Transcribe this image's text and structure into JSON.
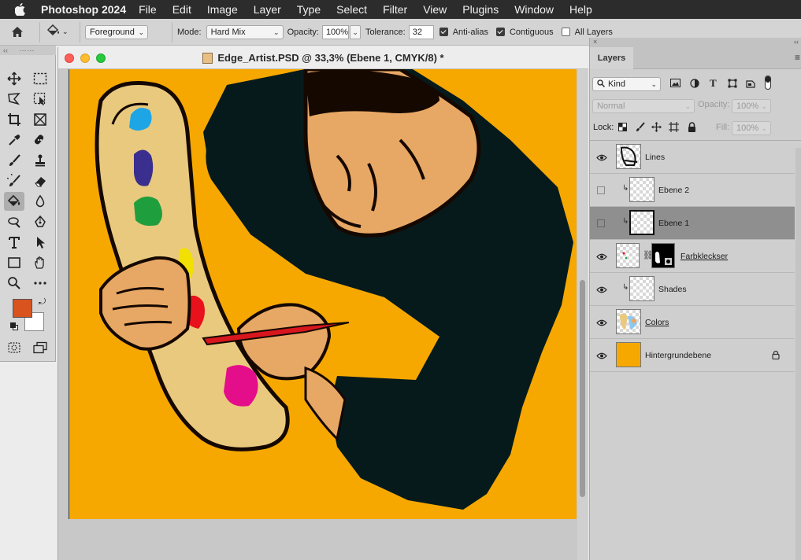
{
  "menubar": {
    "app_name": "Photoshop 2024",
    "items": [
      "File",
      "Edit",
      "Image",
      "Layer",
      "Type",
      "Select",
      "Filter",
      "View",
      "Plugins",
      "Window",
      "Help"
    ]
  },
  "options_bar": {
    "fill_source": "Foreground",
    "mode_label": "Mode:",
    "mode_value": "Hard Mix",
    "opacity_label": "Opacity:",
    "opacity_value": "100%",
    "tolerance_label": "Tolerance:",
    "tolerance_value": "32",
    "anti_alias": {
      "label": "Anti-alias",
      "checked": true
    },
    "contiguous": {
      "label": "Contiguous",
      "checked": true
    },
    "all_layers": {
      "label": "All Layers",
      "checked": false
    }
  },
  "tools": {
    "active": "paint-bucket-tool",
    "foreground_color": "#d9531e",
    "background_color": "#ffffff"
  },
  "document": {
    "title": "Edge_Artist.PSD @ 33,3% (Ebene 1, CMYK/8) *",
    "canvas_background": "#f6a800"
  },
  "layers_panel": {
    "tab_label": "Layers",
    "filter_kind": "Kind",
    "blend_mode": "Normal",
    "opacity_label": "Opacity:",
    "opacity_value": "100%",
    "lock_label": "Lock:",
    "fill_label": "Fill:",
    "fill_value": "100%",
    "layers": [
      {
        "name": "Lines",
        "visible": true,
        "selected": false,
        "clipped": false,
        "underlined": false,
        "locked": false
      },
      {
        "name": "Ebene 2",
        "visible": false,
        "selected": false,
        "clipped": true,
        "underlined": false,
        "locked": false
      },
      {
        "name": "Ebene 1",
        "visible": false,
        "selected": true,
        "clipped": true,
        "underlined": false,
        "locked": false
      },
      {
        "name": "Farbkleckser",
        "visible": true,
        "selected": false,
        "clipped": false,
        "underlined": true,
        "locked": false,
        "has_mask": true
      },
      {
        "name": "Shades",
        "visible": true,
        "selected": false,
        "clipped": true,
        "underlined": false,
        "locked": false
      },
      {
        "name": "Colors",
        "visible": true,
        "selected": false,
        "clipped": false,
        "underlined": true,
        "locked": false
      },
      {
        "name": "Hintergrundebene",
        "visible": true,
        "selected": false,
        "clipped": false,
        "underlined": false,
        "locked": true
      }
    ]
  },
  "colors": {
    "accent_selected_row": "#8f8f8f",
    "canvas_orange": "#f6a800",
    "palette_board": "#e9c97e",
    "skin": "#e8a865",
    "shirt": "#061a1c"
  }
}
